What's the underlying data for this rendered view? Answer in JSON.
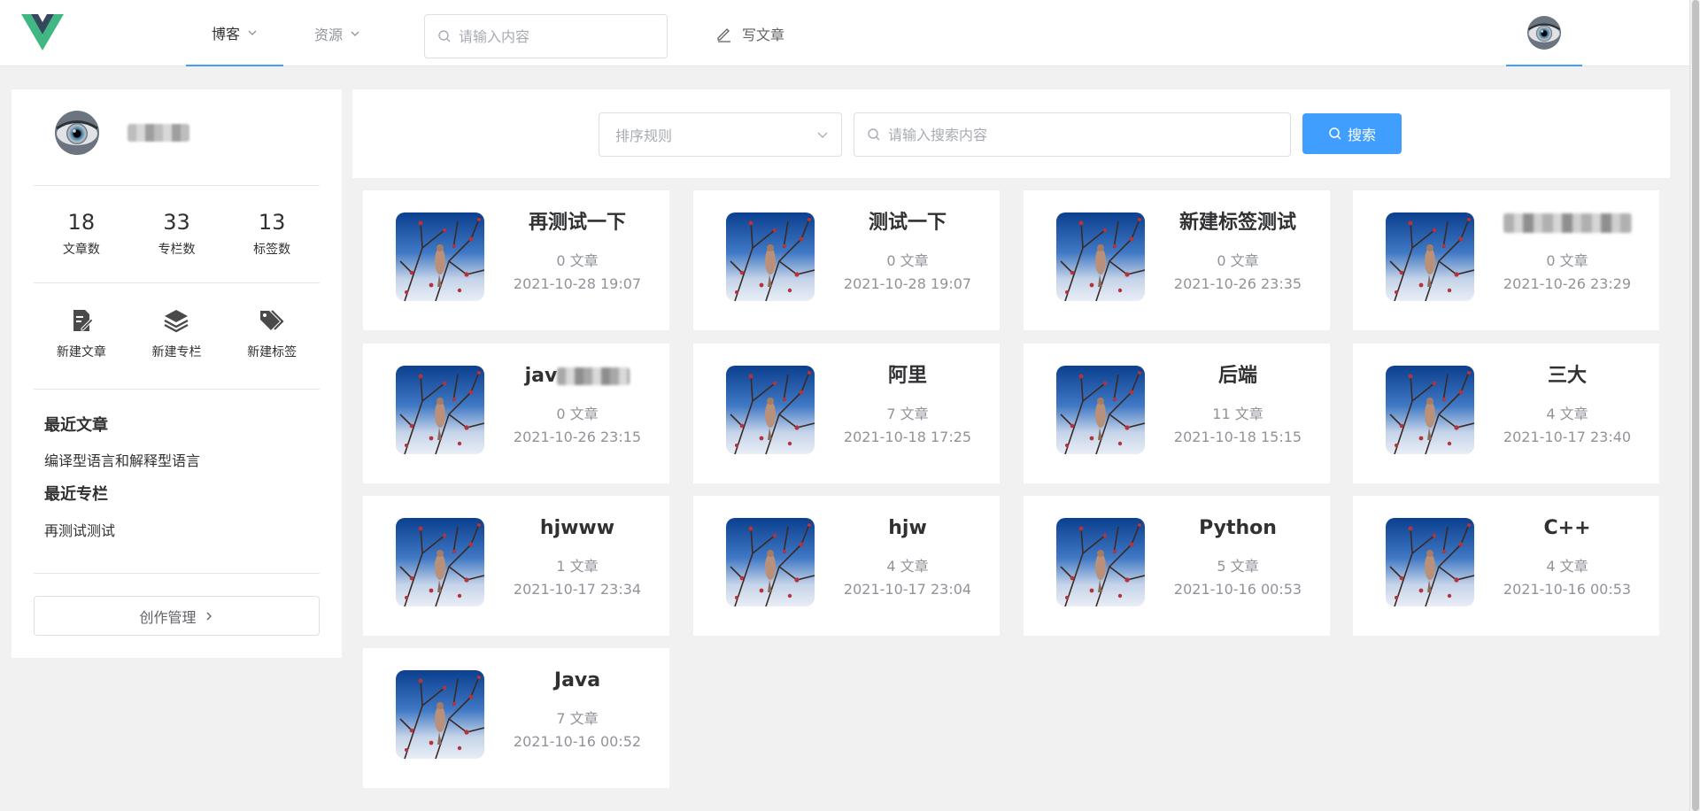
{
  "topbar": {
    "nav": [
      {
        "label": "博客"
      },
      {
        "label": "资源"
      }
    ],
    "search": {
      "placeholder": "请输入内容"
    },
    "write_label": "写文章"
  },
  "sidebar": {
    "stats": [
      {
        "num": "18",
        "label": "文章数"
      },
      {
        "num": "33",
        "label": "专栏数"
      },
      {
        "num": "13",
        "label": "标签数"
      }
    ],
    "actions": [
      {
        "label": "新建文章",
        "icon": "edit-document-icon"
      },
      {
        "label": "新建专栏",
        "icon": "layers-icon"
      },
      {
        "label": "新建标签",
        "icon": "tags-icon"
      }
    ],
    "recent_articles": {
      "title": "最近文章",
      "items": [
        "编译型语言和解释型语言"
      ]
    },
    "recent_columns": {
      "title": "最近专栏",
      "items": [
        "再测试测试"
      ]
    },
    "manage_label": "创作管理"
  },
  "filter": {
    "sort_placeholder": "排序规则",
    "search_placeholder": "请输入搜索内容",
    "search_button": "搜索"
  },
  "cards": [
    {
      "title": "再测试一下",
      "count": "0 文章",
      "date": "2021-10-28 19:07"
    },
    {
      "title": "测试一下",
      "count": "0 文章",
      "date": "2021-10-28 19:07"
    },
    {
      "title": "新建标签测试",
      "count": "0 文章",
      "date": "2021-10-26 23:35"
    },
    {
      "title": "",
      "count": "0 文章",
      "date": "2021-10-26 23:29"
    },
    {
      "title": "jav",
      "count": "0 文章",
      "date": "2021-10-26 23:15"
    },
    {
      "title": "阿里",
      "count": "7 文章",
      "date": "2021-10-18 17:25"
    },
    {
      "title": "后端",
      "count": "11 文章",
      "date": "2021-10-18 15:15"
    },
    {
      "title": "三大",
      "count": "4 文章",
      "date": "2021-10-17 23:40"
    },
    {
      "title": "hjwww",
      "count": "1 文章",
      "date": "2021-10-17 23:34"
    },
    {
      "title": "hjw",
      "count": "4 文章",
      "date": "2021-10-17 23:04"
    },
    {
      "title": "Python",
      "count": "5 文章",
      "date": "2021-10-16 00:53"
    },
    {
      "title": "C++",
      "count": "4 文章",
      "date": "2021-10-16 00:53"
    },
    {
      "title": "Java",
      "count": "7 文章",
      "date": "2021-10-16 00:52"
    }
  ],
  "colors": {
    "accent": "#409eff",
    "page_bg": "#f1f1f1",
    "muted_text": "#909399"
  }
}
